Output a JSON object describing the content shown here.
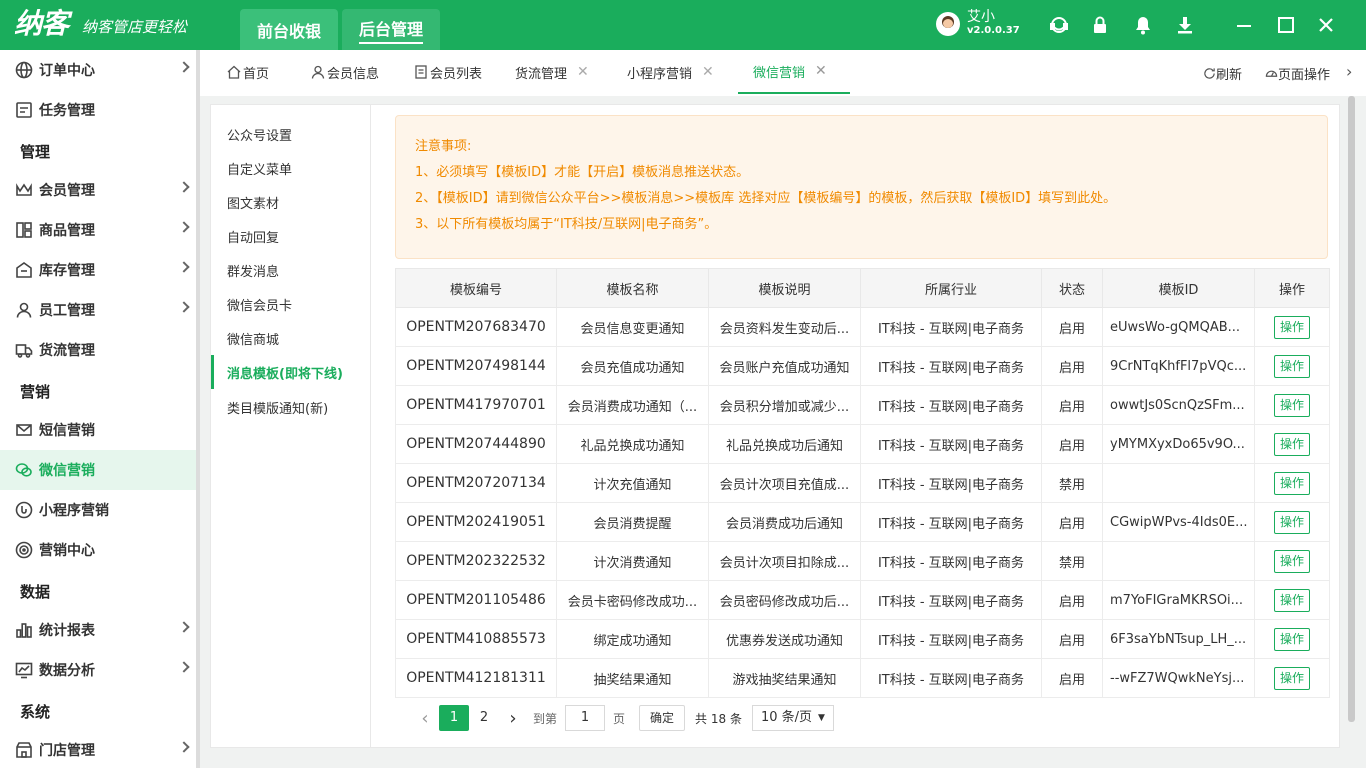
{
  "header": {
    "logo": "纳客",
    "slogan": "纳客管店更轻松",
    "top_tabs": [
      {
        "label": "前台收银",
        "active": false
      },
      {
        "label": "后台管理",
        "active": true
      }
    ],
    "user": {
      "name": "艾小",
      "version": "v2.0.0.37"
    },
    "icons": [
      "headset-icon",
      "lock-icon",
      "bell-icon",
      "download-icon",
      "minimize-icon",
      "maximize-icon",
      "close-icon"
    ]
  },
  "sidebar": {
    "items": [
      {
        "label": "订单中心",
        "icon": "globe-icon",
        "arrow": true
      },
      {
        "label": "任务管理",
        "icon": "task-icon",
        "arrow": false
      },
      {
        "group": "管理"
      },
      {
        "label": "会员管理",
        "icon": "crown-icon",
        "arrow": true
      },
      {
        "label": "商品管理",
        "icon": "goods-icon",
        "arrow": true
      },
      {
        "label": "库存管理",
        "icon": "stock-icon",
        "arrow": true
      },
      {
        "label": "员工管理",
        "icon": "person-icon",
        "arrow": true
      },
      {
        "label": "货流管理",
        "icon": "truck-icon",
        "arrow": false
      },
      {
        "group": "营销"
      },
      {
        "label": "短信营销",
        "icon": "mail-icon",
        "arrow": false
      },
      {
        "label": "微信营销",
        "icon": "wechat-icon",
        "arrow": false,
        "active": true
      },
      {
        "label": "小程序营销",
        "icon": "miniapp-icon",
        "arrow": false
      },
      {
        "label": "营销中心",
        "icon": "target-icon",
        "arrow": false
      },
      {
        "group": "数据"
      },
      {
        "label": "统计报表",
        "icon": "bar-chart-icon",
        "arrow": true
      },
      {
        "label": "数据分析",
        "icon": "analysis-icon",
        "arrow": true
      },
      {
        "group": "系统"
      },
      {
        "label": "门店管理",
        "icon": "store-icon",
        "arrow": true
      }
    ]
  },
  "page_tabs": {
    "items": [
      {
        "label": "首页",
        "icon": "home-icon",
        "closable": false
      },
      {
        "label": "会员信息",
        "icon": "user-icon",
        "closable": false
      },
      {
        "label": "会员列表",
        "icon": "list-icon",
        "closable": false
      },
      {
        "label": "货流管理",
        "closable": true
      },
      {
        "label": "小程序营销",
        "closable": true
      },
      {
        "label": "微信营销",
        "closable": true,
        "active": true
      }
    ],
    "close_glyph": "✕",
    "refresh": "刷新",
    "page_ops": "页面操作"
  },
  "sub_menu": {
    "items": [
      "公众号设置",
      "自定义菜单",
      "图文素材",
      "自动回复",
      "群发消息",
      "微信会员卡",
      "微信商城",
      "消息模板(即将下线)",
      "类目模版通知(新)"
    ],
    "active_index": 7
  },
  "notice": {
    "title": "注意事项:",
    "lines": [
      "1、必须填写【模板ID】才能【开启】模板消息推送状态。",
      "2、【模板ID】请到微信公众平台>>模板消息>>模板库 选择对应【模板编号】的模板，然后获取【模板ID】填写到此处。",
      "3、以下所有模板均属于“IT科技/互联网|电子商务”。"
    ]
  },
  "table": {
    "columns": [
      "模板编号",
      "模板名称",
      "模板说明",
      "所属行业",
      "状态",
      "模板ID",
      "操作"
    ],
    "rows": [
      [
        "OPENTM207683470",
        "会员信息变更通知",
        "会员资料发生变动后...",
        "IT科技 - 互联网|电子商务",
        "启用",
        "eUwsWo-gQMQAB...",
        "操作"
      ],
      [
        "OPENTM207498144",
        "会员充值成功通知",
        "会员账户充值成功通知",
        "IT科技 - 互联网|电子商务",
        "启用",
        "9CrNTqKhfFl7pVQc...",
        "操作"
      ],
      [
        "OPENTM417970701",
        "会员消费成功通知（...",
        "会员积分增加或减少...",
        "IT科技 - 互联网|电子商务",
        "启用",
        "owwtJs0ScnQzSFm...",
        "操作"
      ],
      [
        "OPENTM207444890",
        "礼品兑换成功通知",
        "礼品兑换成功后通知",
        "IT科技 - 互联网|电子商务",
        "启用",
        "yMYMXyxDo65v9O...",
        "操作"
      ],
      [
        "OPENTM207207134",
        "计次充值通知",
        "会员计次项目充值成...",
        "IT科技 - 互联网|电子商务",
        "禁用",
        "",
        "操作"
      ],
      [
        "OPENTM202419051",
        "会员消费提醒",
        "会员消费成功后通知",
        "IT科技 - 互联网|电子商务",
        "启用",
        "CGwipWPvs-4Ids0E...",
        "操作"
      ],
      [
        "OPENTM202322532",
        "计次消费通知",
        "会员计次项目扣除成...",
        "IT科技 - 互联网|电子商务",
        "禁用",
        "",
        "操作"
      ],
      [
        "OPENTM201105486",
        "会员卡密码修改成功...",
        "会员密码修改成功后...",
        "IT科技 - 互联网|电子商务",
        "启用",
        "m7YoFIGraMKRSOi...",
        "操作"
      ],
      [
        "OPENTM410885573",
        "绑定成功通知",
        "优惠券发送成功通知",
        "IT科技 - 互联网|电子商务",
        "启用",
        "6F3saYbNTsup_LH_...",
        "操作"
      ],
      [
        "OPENTM412181311",
        "抽奖结果通知",
        "游戏抽奖结果通知",
        "IT科技 - 互联网|电子商务",
        "启用",
        "--wFZ7WQwkNeYsj...",
        "操作"
      ]
    ]
  },
  "pager": {
    "prev": "‹",
    "next": "›",
    "pages": [
      "1",
      "2"
    ],
    "current": "1",
    "goto_label": "到第",
    "goto_value": "1",
    "page_unit": "页",
    "confirm": "确定",
    "total": "共 18 条",
    "page_size": "10 条/页",
    "caret": "▼"
  },
  "colors": {
    "brand": "#1aad5c",
    "notice_text": "#f08a00",
    "notice_bg": "#fef5ea"
  }
}
